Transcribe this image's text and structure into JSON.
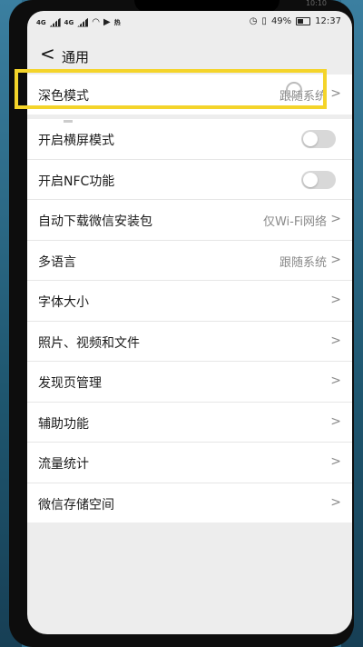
{
  "status_bar": {
    "signal_left": "4G",
    "signal_right": "4G",
    "app_badge": "热",
    "battery_percent": "49%",
    "time": "12:37",
    "ghost_time": "10:10"
  },
  "header": {
    "title": "通用"
  },
  "settings": {
    "dark_mode": {
      "label": "深色模式",
      "value": "跟随系统"
    },
    "landscape": {
      "label": "开启横屏模式",
      "enabled": false
    },
    "nfc": {
      "label": "开启NFC功能",
      "enabled": false
    },
    "auto_download": {
      "label": "自动下载微信安装包",
      "value": "仅Wi-Fi网络"
    },
    "language": {
      "label": "多语言",
      "value": "跟随系统"
    },
    "font_size": {
      "label": "字体大小"
    },
    "media": {
      "label": "照片、视频和文件"
    },
    "discover": {
      "label": "发现页管理"
    },
    "accessibility": {
      "label": "辅助功能"
    },
    "traffic": {
      "label": "流量统计"
    },
    "storage": {
      "label": "微信存储空间"
    }
  },
  "glyphs": {
    "chevron": ">",
    "back": "<"
  }
}
